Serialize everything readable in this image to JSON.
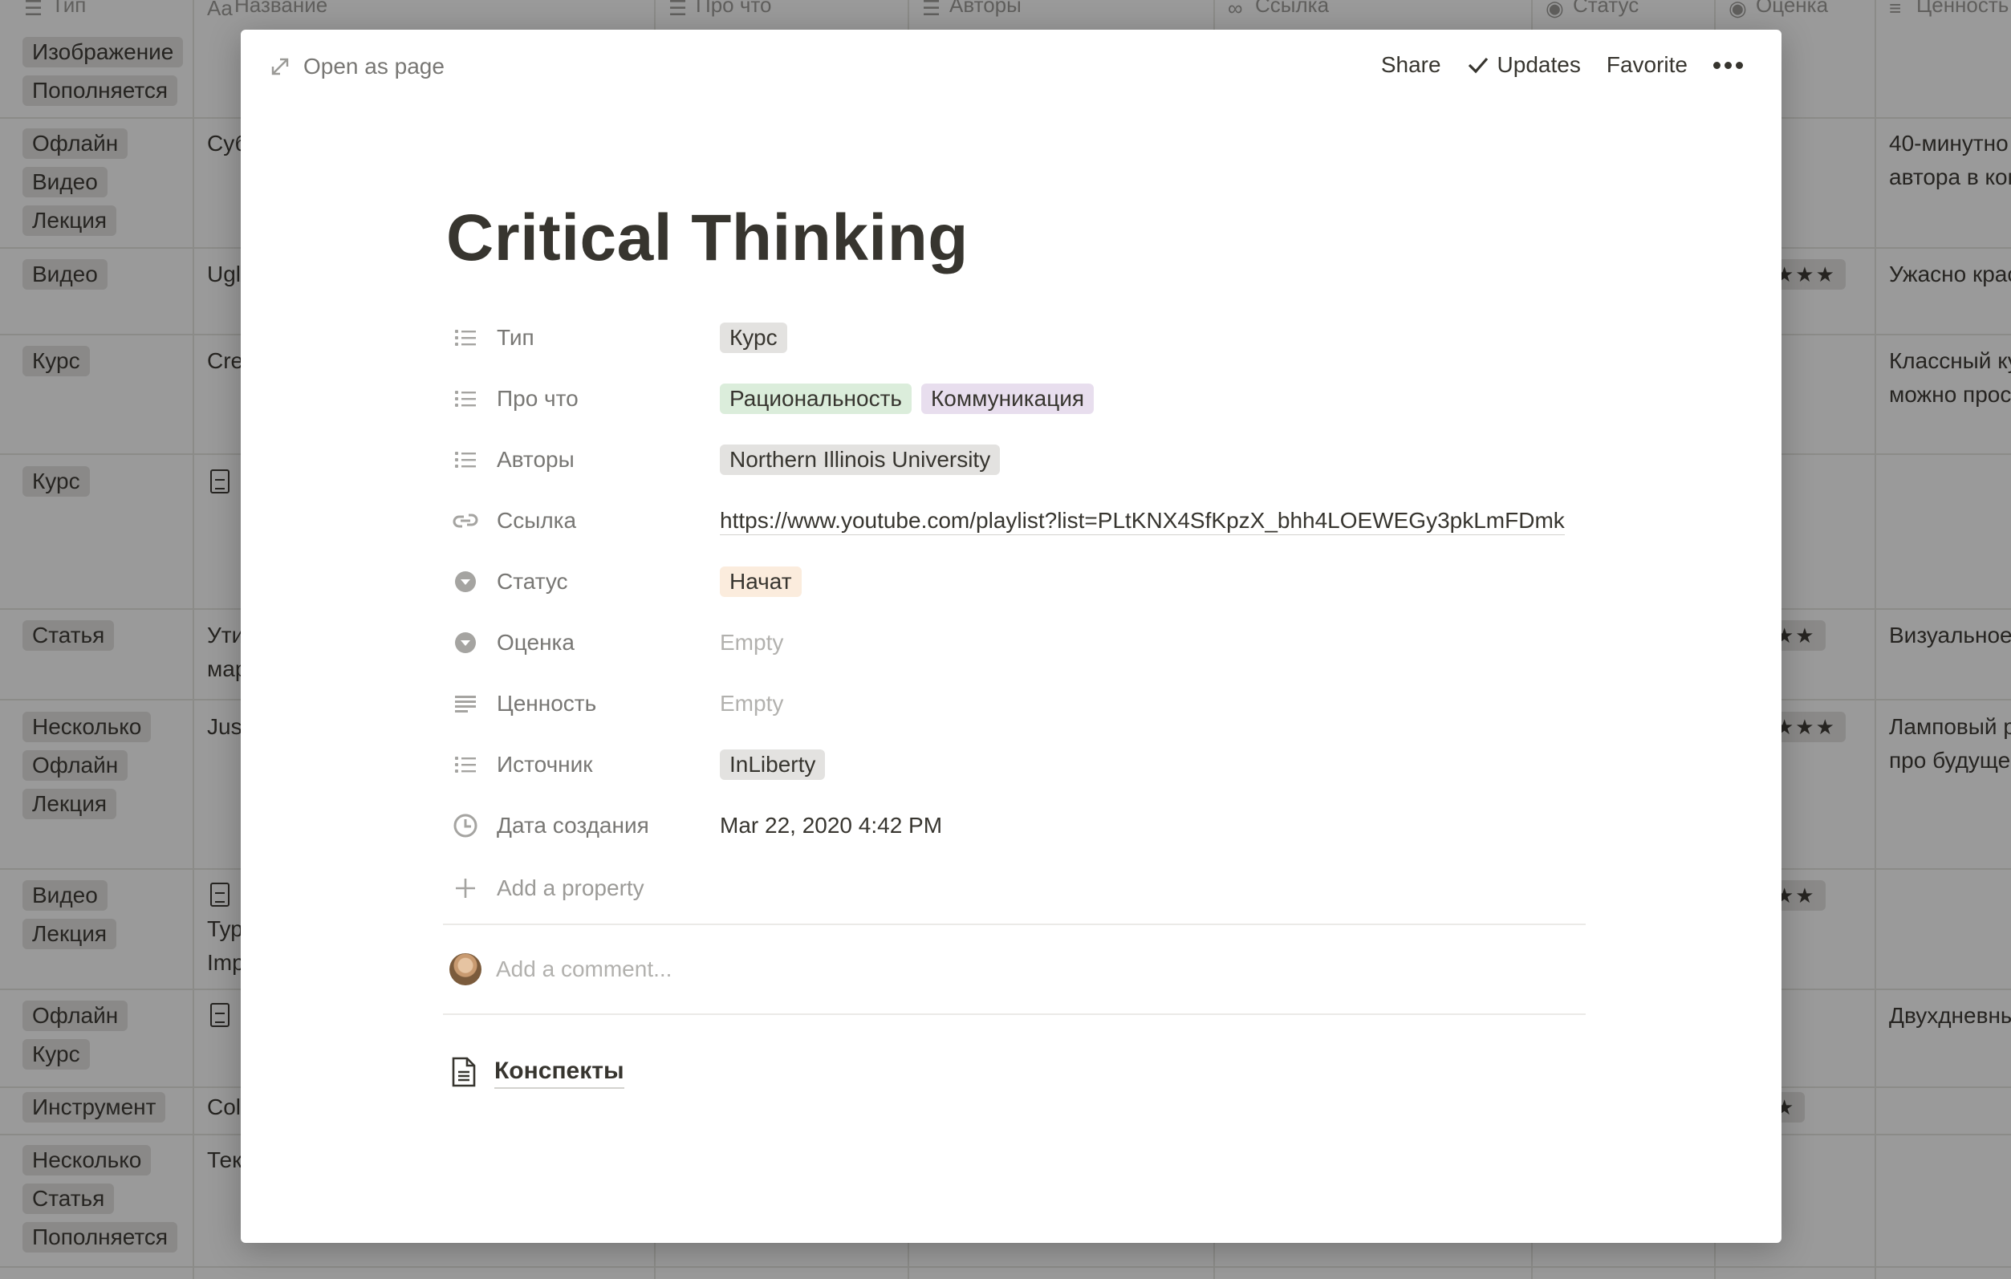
{
  "background": {
    "headers": [
      "Тип",
      "Название",
      "Про что",
      "Авторы",
      "Ссылка",
      "Статус",
      "Оценка",
      "Ценность"
    ],
    "type_tags": [
      [
        "Изображение",
        "Пополняется"
      ],
      [
        "Офлайн",
        "Видео",
        "Лекция"
      ],
      [
        "Видео"
      ],
      [
        "Курс"
      ],
      [
        "Курс"
      ],
      [
        "Статья"
      ],
      [
        "Несколько",
        "Офлайн",
        "Лекция"
      ],
      [
        "Видео",
        "Лекция"
      ],
      [
        "Офлайн",
        "Курс"
      ],
      [
        "Инструмент"
      ],
      [
        "Несколько",
        "Статья",
        "Пополняется"
      ]
    ],
    "name_fragments": [
      "Суб",
      "Ugl",
      "Cre",
      "Ути",
      "мар",
      "Jus",
      "Тур",
      "Imp",
      "Col",
      "Тек"
    ],
    "star_fragments": [
      "★★★",
      "★★",
      "★★★",
      "★★",
      "★"
    ],
    "value_texts": [
      "40-минутно",
      "автора в ком",
      "Ужасно крас",
      "Классный ку",
      "можно прос",
      "Визуальное",
      "Ламповый р",
      "про будуще",
      "Двухдневны"
    ]
  },
  "modal": {
    "open_as_page": "Open as page",
    "actions": {
      "share": "Share",
      "updates": "Updates",
      "favorite": "Favorite"
    },
    "title": "Critical Thinking",
    "properties": [
      {
        "name": "Тип",
        "icon": "list-icon",
        "tags": [
          {
            "text": "Курс",
            "color": "#e3e2e0"
          }
        ]
      },
      {
        "name": "Про что",
        "icon": "list-icon",
        "tags": [
          {
            "text": "Рациональность",
            "color": "#dbeddb"
          },
          {
            "text": "Коммуникация",
            "color": "#e8deee"
          }
        ]
      },
      {
        "name": "Авторы",
        "icon": "list-icon",
        "tags": [
          {
            "text": "Northern Illinois University",
            "color": "#e3e2e0"
          }
        ]
      },
      {
        "name": "Ссылка",
        "icon": "link-icon",
        "url": "https://www.youtube.com/playlist?list=PLtKNX4SfKpzX_bhh4LOEWEGy3pkLmFDmk"
      },
      {
        "name": "Статус",
        "icon": "select-icon",
        "tags": [
          {
            "text": "Начат",
            "color": "#fbecdd"
          }
        ]
      },
      {
        "name": "Оценка",
        "icon": "select-icon",
        "empty": "Empty"
      },
      {
        "name": "Ценность",
        "icon": "text-icon",
        "empty": "Empty"
      },
      {
        "name": "Источник",
        "icon": "list-icon",
        "tags": [
          {
            "text": "InLiberty",
            "color": "#e3e2e0"
          }
        ]
      },
      {
        "name": "Дата создания",
        "icon": "clock-icon",
        "value": "Mar 22, 2020 4:42 PM"
      }
    ],
    "add_property": "Add a property",
    "comment_placeholder": "Add a comment...",
    "subpage": "Конспекты"
  }
}
